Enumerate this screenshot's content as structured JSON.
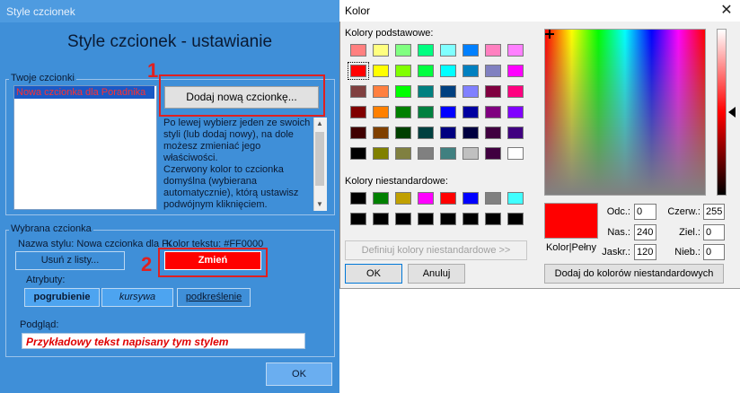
{
  "left_window": {
    "title": "Style czcionek",
    "heading": "Style czcionek - ustawianie",
    "fonts_group": {
      "label": "Twoje czcionki",
      "list_items": [
        "Nowa czcionka dla Poradnika"
      ],
      "add_button": "Dodaj nową czcionkę...",
      "info_text": "Po lewej wybierz jeden ze swoich styli (lub dodaj nowy), na dole możesz zmieniać jego właściwości.\nCzerwony kolor to czcionka domyślna (wybierana automatycznie), którą ustawisz podwójnym kliknięciem."
    },
    "selected_group": {
      "label": "Wybrana czcionka",
      "style_name_text": "Nazwa stylu: Nowa czcionka dla Poradnika",
      "text_color_text": "Kolor tekstu: #FF0000",
      "remove_button": "Usuń z listy...",
      "change_button": "Zmień",
      "attributes_label": "Atrybuty:",
      "bold_button": "pogrubienie",
      "italic_button": "kursywa",
      "underline_button": "podkreślenie",
      "preview_label": "Podgląd:",
      "preview_text": "Przykładowy tekst napisany tym stylem"
    },
    "ok_button": "OK",
    "annotations": [
      "1",
      "2"
    ]
  },
  "color_dialog": {
    "title": "Kolor",
    "basic_colors_label": "Kolory podstawowe:",
    "basic_colors": [
      [
        "#ff8080",
        "#ffff80",
        "#80ff80",
        "#00ff80",
        "#80ffff",
        "#0080ff",
        "#ff80c0",
        "#ff80ff"
      ],
      [
        "#ff0000",
        "#ffff00",
        "#80ff00",
        "#00ff40",
        "#00ffff",
        "#0080c0",
        "#8080c0",
        "#ff00ff"
      ],
      [
        "#804040",
        "#ff8040",
        "#00ff00",
        "#008080",
        "#004080",
        "#8080ff",
        "#800040",
        "#ff0080"
      ],
      [
        "#800000",
        "#ff8000",
        "#008000",
        "#008040",
        "#0000ff",
        "#0000a0",
        "#800080",
        "#8000ff"
      ],
      [
        "#400000",
        "#804000",
        "#004000",
        "#004040",
        "#000080",
        "#000040",
        "#400040",
        "#400080"
      ],
      [
        "#000000",
        "#808000",
        "#808040",
        "#808080",
        "#408080",
        "#c0c0c0",
        "#400040",
        "#ffffff"
      ]
    ],
    "selected_basic": [
      1,
      0
    ],
    "custom_colors_label": "Kolory niestandardowe:",
    "custom_colors": [
      [
        "#000000",
        "#008000",
        "#c0a000",
        "#ff00ff",
        "#ff0000",
        "#0000ff",
        "#808080",
        "#40ffff"
      ],
      [
        "#000000",
        "#000000",
        "#000000",
        "#000000",
        "#000000",
        "#000000",
        "#000000",
        "#000000"
      ]
    ],
    "define_custom_button": "Definiuj kolory niestandardowe >>",
    "ok_button": "OK",
    "cancel_button": "Anuluj",
    "color_solid_label": "Kolor|Pełny",
    "hue_label": "Odc.:",
    "hue_value": "0",
    "sat_label": "Nas.:",
    "sat_value": "240",
    "lum_label": "Jaskr.:",
    "lum_value": "120",
    "red_label": "Czerw.:",
    "red_value": "255",
    "green_label": "Ziel.:",
    "green_value": "0",
    "blue_label": "Nieb.:",
    "blue_value": "0",
    "add_custom_button": "Dodaj do kolorów niestandardowych",
    "current_color": "#ff0000"
  }
}
